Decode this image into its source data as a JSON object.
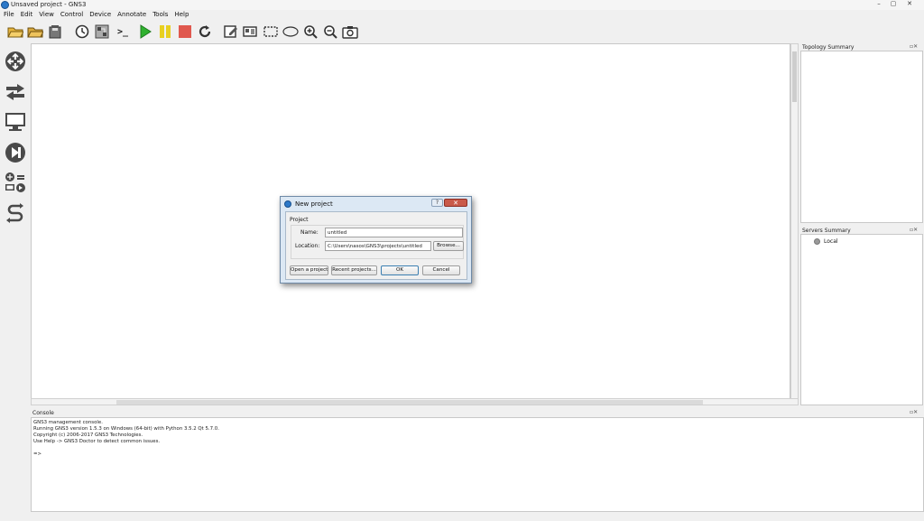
{
  "window": {
    "title": "Unsaved project - GNS3",
    "controls": [
      "–",
      "▢",
      "✕"
    ]
  },
  "menu": [
    "File",
    "Edit",
    "View",
    "Control",
    "Device",
    "Annotate",
    "Tools",
    "Help"
  ],
  "toolbar": {
    "icons": [
      "open-folder-icon",
      "open-project-icon",
      "save-snapshot-icon",
      "clock-icon",
      "topology-icon",
      "console-terminal-icon",
      "start-icon",
      "pause-icon",
      "stop-icon",
      "reload-icon",
      "add-note-icon",
      "insert-picture-icon",
      "draw-rectangle-icon",
      "draw-ellipse-icon",
      "zoom-in-icon",
      "zoom-out-icon",
      "screenshot-icon"
    ],
    "terminal_glyph": ">_"
  },
  "palette": [
    "routers-icon",
    "switches-icon",
    "end-devices-icon",
    "security-devices-icon",
    "all-devices-icon",
    "add-link-icon"
  ],
  "topology_summary": {
    "title": "Topology Summary"
  },
  "servers_summary": {
    "title": "Servers Summary",
    "servers": [
      "Local"
    ]
  },
  "console": {
    "title": "Console",
    "lines": [
      "GNS3 management console.",
      "Running GNS3 version 1.5.3 on Windows (64-bit) with Python 3.5.2 Qt 5.7.0.",
      "Copyright (c) 2006-2017 GNS3 Technologies.",
      "Use Help -> GNS3 Doctor to detect common issues.",
      "",
      "=>"
    ]
  },
  "dialog": {
    "title": "New project",
    "help_glyph": "?",
    "close_glyph": "✕",
    "group_label": "Project",
    "name_label": "Name:",
    "name_value": "untitled",
    "location_label": "Location:",
    "location_value": "C:\\Users\\nasos\\GNS3\\projects\\untitled",
    "browse_label": "Browse...",
    "open_project_label": "Open a project",
    "recent_projects_label": "Recent projects...",
    "ok_label": "OK",
    "cancel_label": "Cancel"
  },
  "dock_button_glyphs": "▫✕",
  "colors": {
    "start": "#2fb12f",
    "pause": "#e8d020",
    "stop": "#e0584e",
    "dialog_frame": "#dce8f4"
  }
}
